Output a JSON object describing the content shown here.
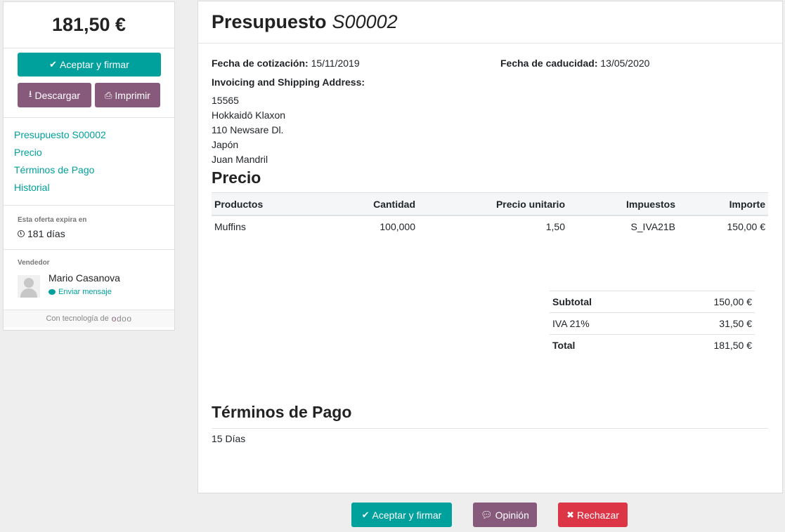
{
  "sidebar": {
    "amount": "181,50 €",
    "accept_label": "Aceptar y firmar",
    "download_label": "Descargar",
    "print_label": "Imprimir",
    "nav": [
      {
        "label": "Presupuesto S00002"
      },
      {
        "label": "Precio"
      },
      {
        "label": "Términos de Pago"
      },
      {
        "label": "Historial"
      }
    ],
    "expire_label": "Esta oferta expira en",
    "expire_value": "181 días",
    "seller_label": "Vendedor",
    "seller_name": "Mario Casanova",
    "send_message": "Enviar mensaje",
    "powered_by": "Con tecnología de",
    "logo_text": "odoo"
  },
  "main": {
    "title": "Presupuesto",
    "number": "S00002",
    "quote_date_label": "Fecha de cotización:",
    "quote_date": "15/11/2019",
    "expiry_date_label": "Fecha de caducidad:",
    "expiry_date": "13/05/2020",
    "address_title": "Invoicing and Shipping Address:",
    "address_lines": [
      "15565",
      "Hokkaidō Klaxon",
      "110 Newsare Dl.",
      "Japón",
      "Juan Mandril"
    ],
    "price_title": "Precio",
    "columns": [
      "Productos",
      "Cantidad",
      "Precio unitario",
      "Impuestos",
      "Importe"
    ],
    "rows": [
      [
        "Muffins",
        "100,000",
        "1,50",
        "S_IVA21B",
        "150,00 €"
      ]
    ],
    "totals": [
      {
        "label": "Subtotal",
        "value": "150,00 €",
        "bold": true
      },
      {
        "label": "IVA 21%",
        "value": "31,50 €",
        "bold": false
      },
      {
        "label": "Total",
        "value": "181,50 €",
        "bold": true
      }
    ],
    "terms_title": "Términos de Pago",
    "terms_value": "15 Días"
  },
  "footer": {
    "accept_label": "Aceptar y firmar",
    "feedback_label": "Opinión",
    "reject_label": "Rechazar"
  },
  "colors": {
    "primary": "#00a09d",
    "secondary": "#875a7b",
    "danger": "#dc3545"
  }
}
